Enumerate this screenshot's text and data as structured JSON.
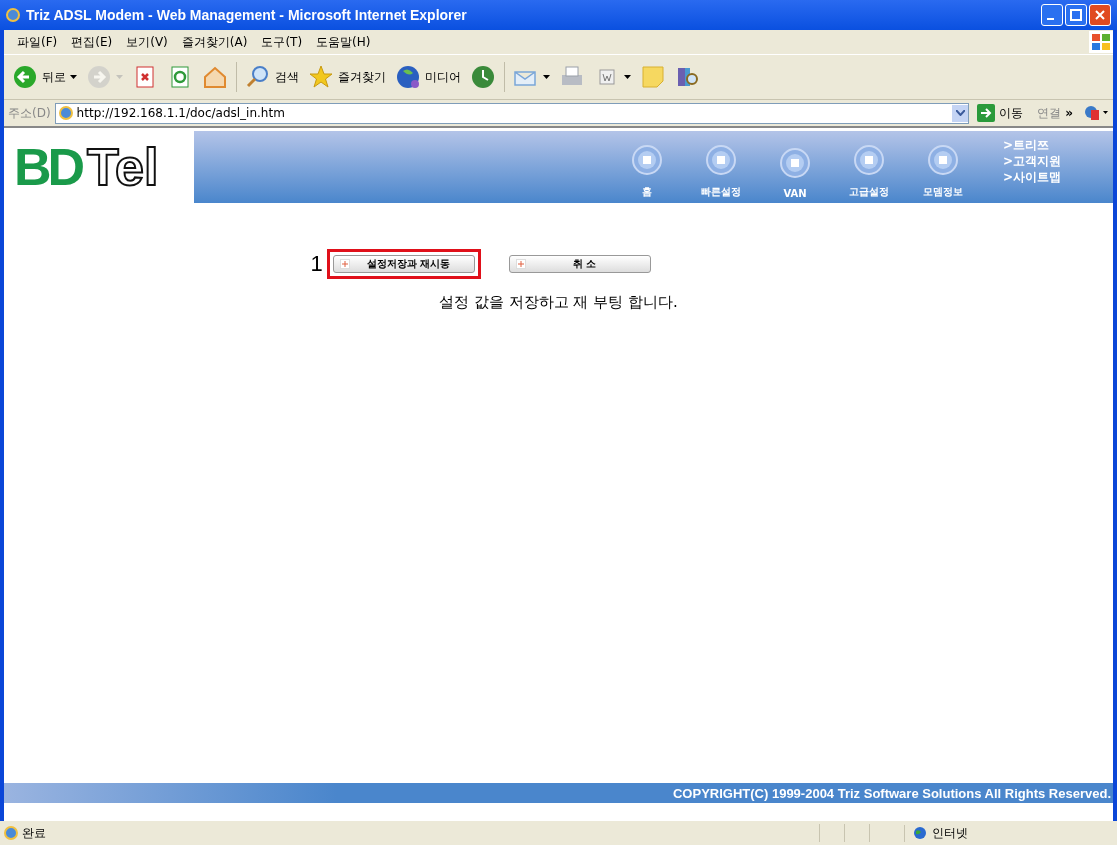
{
  "window": {
    "title": "Triz ADSL Modem - Web Management - Microsoft Internet Explorer"
  },
  "menu": [
    "파일(F)",
    "편집(E)",
    "보기(V)",
    "즐겨찾기(A)",
    "도구(T)",
    "도움말(H)"
  ],
  "toolbar": [
    {
      "kind": "back",
      "label": "뒤로",
      "dropdown": true,
      "disabled": false
    },
    {
      "kind": "forward",
      "dropdown": true,
      "disabled": true
    },
    {
      "kind": "stop",
      "dropdown": false,
      "disabled": false
    },
    {
      "kind": "refresh",
      "dropdown": false,
      "disabled": false
    },
    {
      "kind": "home",
      "dropdown": false,
      "disabled": false
    },
    {
      "kind": "search",
      "label": "검색",
      "dropdown": false,
      "disabled": false
    },
    {
      "kind": "favorites",
      "label": "즐겨찾기",
      "dropdown": false,
      "disabled": false
    },
    {
      "kind": "media",
      "label": "미디어",
      "dropdown": false,
      "disabled": false
    },
    {
      "kind": "history",
      "dropdown": false,
      "disabled": false
    },
    {
      "kind": "mail",
      "dropdown": true,
      "disabled": false
    },
    {
      "kind": "print",
      "dropdown": false,
      "disabled": false
    },
    {
      "kind": "word",
      "dropdown": true,
      "disabled": false
    },
    {
      "kind": "note",
      "dropdown": false,
      "disabled": false
    },
    {
      "kind": "research",
      "dropdown": false,
      "disabled": false
    }
  ],
  "address_bar": {
    "label": "주소(D)",
    "url": "http://192.168.1.1/doc/adsl_in.htm",
    "go": "이동",
    "links": "연결",
    "chevron": "»"
  },
  "page": {
    "logo": {
      "part_1": "BD",
      "part_2": "Tel"
    },
    "nav": [
      "홈",
      "빠른설정",
      "VAN",
      "고급설정",
      "모뎀정보"
    ],
    "side_links": [
      ">트리쯔",
      ">고객지원",
      ">사이트맵"
    ],
    "annotation": "1",
    "buttons": [
      {
        "label": "설정저장과 재시동",
        "highlighted": true
      },
      {
        "label": "취 소",
        "highlighted": false
      }
    ],
    "message": "설정 값을 저장하고 재 부팅 합니다.",
    "footer": "COPYRIGHT(C) 1999-2004 Triz Software Solutions All Rights Reserved."
  },
  "status_bar": {
    "text": "완료",
    "zone": "인터넷"
  }
}
